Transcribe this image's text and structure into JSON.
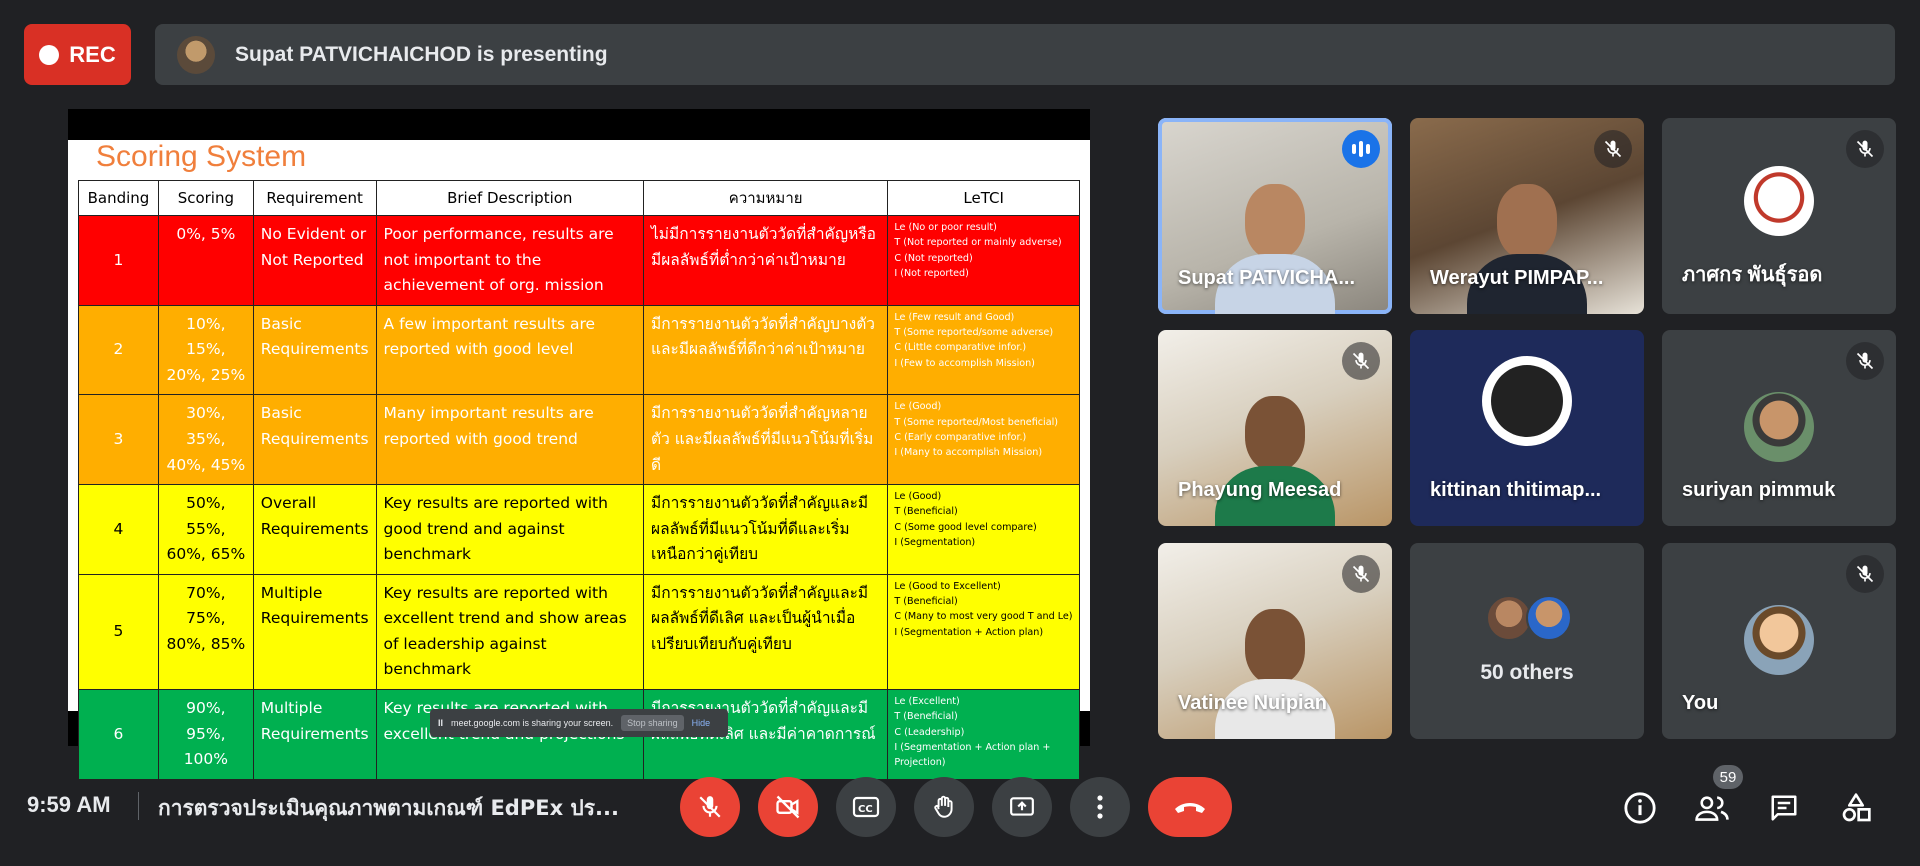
{
  "rec": {
    "label": "REC"
  },
  "presenter": {
    "text": "Supat PATVICHAICHOD is presenting"
  },
  "slide": {
    "title": "Scoring System",
    "headers": [
      "Banding",
      "Scoring",
      "Requirement",
      "Brief Description",
      "ความหมาย",
      "LeTCI"
    ],
    "rows": [
      {
        "band": "1",
        "scoring": "0%, 5%",
        "req": "No Evident or Not Reported",
        "desc": "Poor performance, results are not important to the achievement of org. mission",
        "thai": "ไม่มีการรายงานตัววัดที่สำคัญหรือมีผลลัพธ์ที่ต่ำกว่าค่าเป้าหมาย",
        "letci": [
          "Le (No or poor result)",
          "T (Not reported or mainly adverse)",
          "C (Not reported)",
          "I (Not reported)"
        ]
      },
      {
        "band": "2",
        "scoring": "10%, 15%, 20%, 25%",
        "req": "Basic Requirements",
        "desc": "A few important results are reported with good level",
        "thai": "มีการรายงานตัววัดที่สำคัญบางตัว และมีผลลัพธ์ที่ดีกว่าค่าเป้าหมาย",
        "letci": [
          "Le (Few result and Good)",
          "T (Some reported/some adverse)",
          "C (Little comparative infor.)",
          "I (Few to accomplish Mission)"
        ]
      },
      {
        "band": "3",
        "scoring": "30%, 35%, 40%, 45%",
        "req": "Basic Requirements",
        "desc": "Many important results are reported with good trend",
        "thai": "มีการรายงานตัววัดที่สำคัญหลายตัว และมีผลลัพธ์ที่มีแนวโน้มที่เริ่มดี",
        "letci": [
          "Le (Good)",
          "T (Some reported/Most beneficial)",
          "C (Early comparative infor.)",
          "I (Many to accomplish Mission)"
        ]
      },
      {
        "band": "4",
        "scoring": "50%, 55%, 60%, 65%",
        "req": "Overall Requirements",
        "desc": "Key results are reported with good trend and against benchmark",
        "thai": "มีการรายงานตัววัดที่สำคัญและมีผลลัพธ์ที่มีแนวโน้มที่ดีและเริ่มเหนือกว่าคู่เทียบ",
        "letci": [
          "Le (Good)",
          "T (Beneficial)",
          "C (Some good level compare)",
          "I (Segmentation)"
        ]
      },
      {
        "band": "5",
        "scoring": "70%, 75%, 80%, 85%",
        "req": "Multiple Requirements",
        "desc": "Key results are reported with excellent trend and show areas of leadership against benchmark",
        "thai": "มีการรายงานตัววัดที่สำคัญและมีผลลัพธ์ที่ดีเลิศ และเป็นผู้นำเมื่อเปรียบเทียบกับคู่เทียบ",
        "letci": [
          "Le (Good to Excellent)",
          "T (Beneficial)",
          "C (Many to most very good T and Le)",
          "I (Segmentation + Action plan)"
        ]
      },
      {
        "band": "6",
        "scoring": "90%, 95%, 100%",
        "req": "Multiple Requirements",
        "desc": "Key results are reported with excellent trend and projections",
        "thai": "มีการรายงานตัววัดที่สำคัญและมีผลลัพธ์ที่ดีเลิศ และมีค่าคาดการณ์",
        "letci": [
          "Le (Excellent)",
          "T (Beneficial)",
          "C (Leadership)",
          "I (Segmentation + Action plan + Projection)"
        ]
      }
    ]
  },
  "share_notice": {
    "pause": "II",
    "text": "meet.google.com is sharing your screen.",
    "stop": "Stop sharing",
    "hide": "Hide"
  },
  "tiles": [
    {
      "name": "Supat PATVICHA...",
      "icon": "speaking-icon"
    },
    {
      "name": "Werayut PIMPAP...",
      "icon": "mic-off-icon"
    },
    {
      "name": "ภาศกร พันธุ์รอด",
      "icon": "mic-off-icon"
    },
    {
      "name": "Phayung Meesad",
      "icon": "mic-off-icon"
    },
    {
      "name": "kittinan thitimap...",
      "icon": "obs-logo"
    },
    {
      "name": "suriyan pimmuk",
      "icon": "mic-off-icon"
    },
    {
      "name": "Vatinee Nuipian",
      "icon": "mic-off-icon"
    },
    {
      "name": "50 others",
      "icon": "avatars"
    },
    {
      "name": "You",
      "icon": "mic-off-icon"
    }
  ],
  "bottom": {
    "time": "9:59 AM",
    "meeting_title": "การตรวจประเมินคุณภาพตามเกณฑ์ EdPEx ปร...",
    "participants_count": "59"
  },
  "colors": {
    "accent_blue": "#8ab4f8",
    "red": "#ea4335",
    "bg": "#202124",
    "tile": "#3c4043"
  }
}
